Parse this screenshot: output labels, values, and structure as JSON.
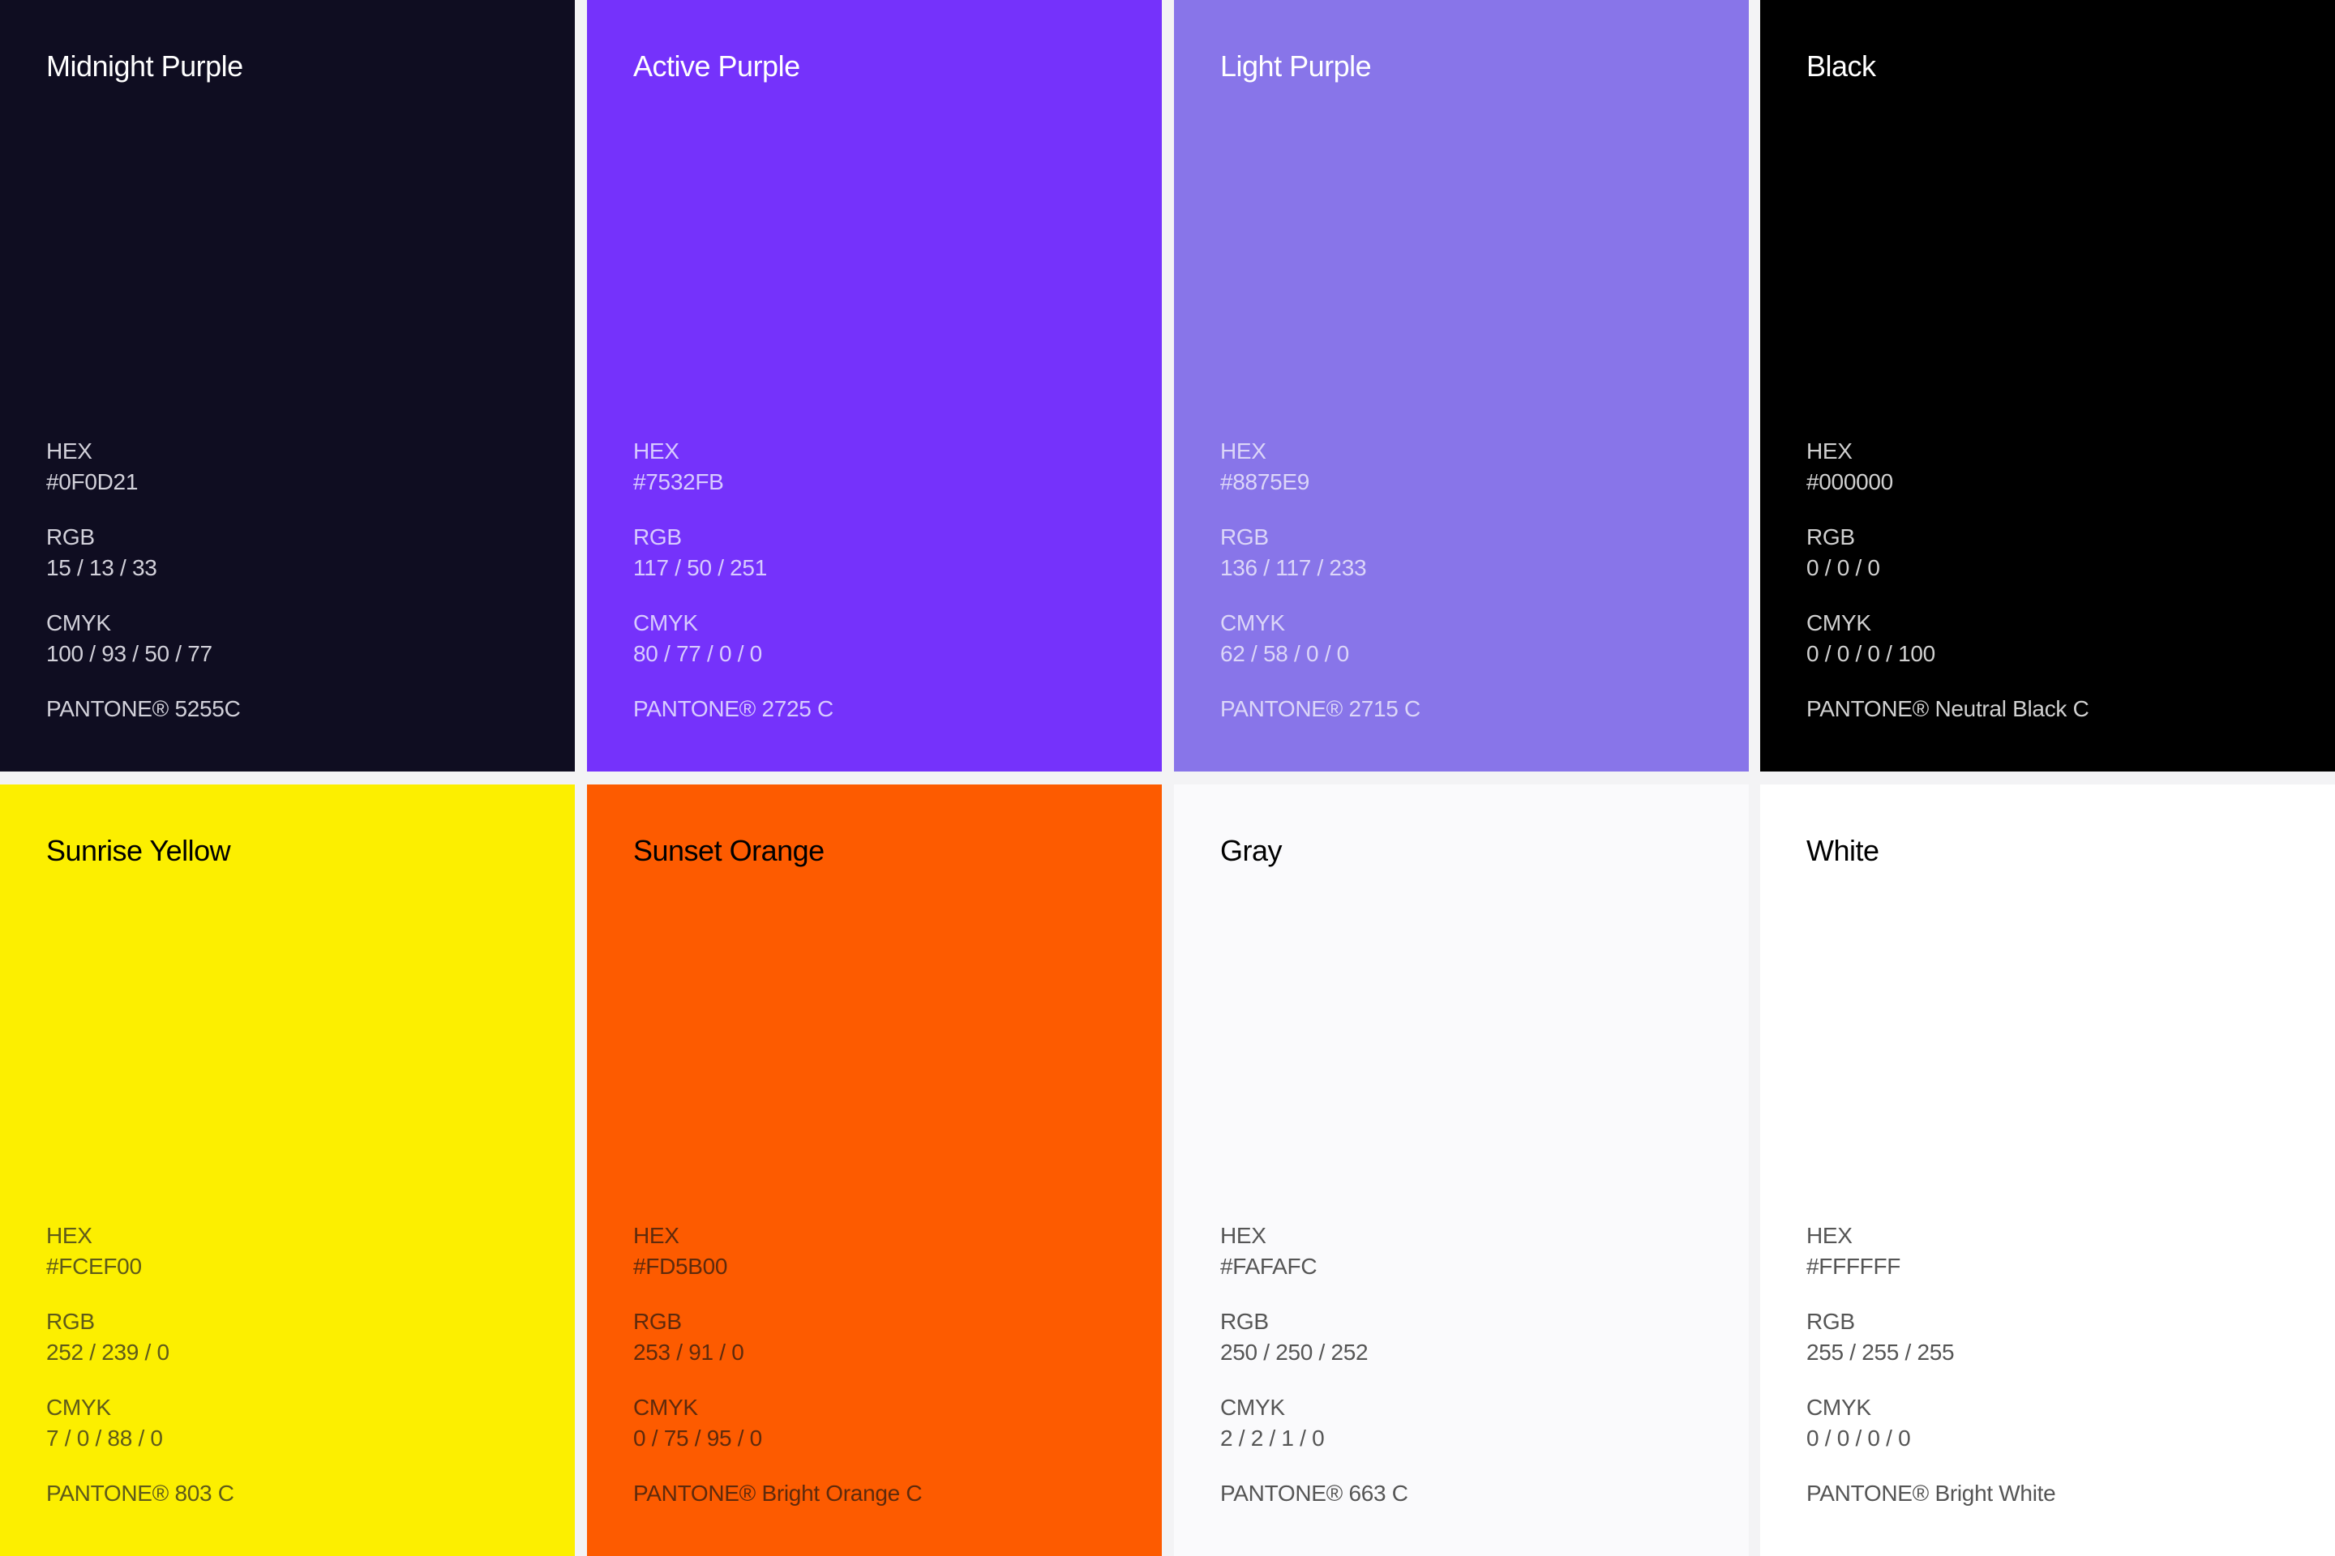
{
  "swatches": [
    {
      "name": "Midnight Purple",
      "bg": "#0F0D21",
      "name_color": "#FFFFFF",
      "text_color": "#D2D1DA",
      "hex_label": "HEX",
      "hex": "#0F0D21",
      "rgb_label": "RGB",
      "rgb": "15 / 13 / 33",
      "cmyk_label": "CMYK",
      "cmyk": "100 / 93 / 50 / 77",
      "pantone": "PANTONE® 5255C"
    },
    {
      "name": "Active Purple",
      "bg": "#7532FB",
      "name_color": "#FFFFFF",
      "text_color": "#D8CBFE",
      "hex_label": "HEX",
      "hex": "#7532FB",
      "rgb_label": "RGB",
      "rgb": "117 / 50 / 251",
      "cmyk_label": "CMYK",
      "cmyk": "80 / 77 / 0 / 0",
      "pantone": "PANTONE® 2725 C"
    },
    {
      "name": "Light Purple",
      "bg": "#8875E9",
      "name_color": "#FFFFFF",
      "text_color": "#DCD6F8",
      "hex_label": "HEX",
      "hex": "#8875E9",
      "rgb_label": "RGB",
      "rgb": "136 / 117 / 233",
      "cmyk_label": "CMYK",
      "cmyk": "62 / 58 / 0 / 0",
      "pantone": "PANTONE® 2715 C"
    },
    {
      "name": "Black",
      "bg": "#000000",
      "name_color": "#FFFFFF",
      "text_color": "#D0D0D0",
      "hex_label": "HEX",
      "hex": "#000000",
      "rgb_label": "RGB",
      "rgb": "0 / 0 / 0",
      "cmyk_label": "CMYK",
      "cmyk": "0 / 0 / 0 / 100",
      "pantone": "PANTONE® Neutral Black C"
    },
    {
      "name": "Sunrise Yellow",
      "bg": "#FCEF00",
      "name_color": "#000000",
      "text_color": "#5E5A1A",
      "hex_label": "HEX",
      "hex": "#FCEF00",
      "rgb_label": "RGB",
      "rgb": "252 / 239 / 0",
      "cmyk_label": "CMYK",
      "cmyk": "7 / 0 / 88 / 0",
      "pantone": "PANTONE® 803 C"
    },
    {
      "name": "Sunset Orange",
      "bg": "#FD5B00",
      "name_color": "#000000",
      "text_color": "#5E2A0C",
      "hex_label": "HEX",
      "hex": "#FD5B00",
      "rgb_label": "RGB",
      "rgb": "253 / 91 / 0",
      "cmyk_label": "CMYK",
      "cmyk": "0 / 75 / 95 / 0",
      "pantone": "PANTONE® Bright Orange C"
    },
    {
      "name": "Gray",
      "bg": "#FAFAFC",
      "name_color": "#000000",
      "text_color": "#555555",
      "hex_label": "HEX",
      "hex": "#FAFAFC",
      "rgb_label": "RGB",
      "rgb": "250 / 250 / 252",
      "cmyk_label": "CMYK",
      "cmyk": "2 / 2 / 1 / 0",
      "pantone": "PANTONE® 663 C"
    },
    {
      "name": "White",
      "bg": "#FFFFFF",
      "name_color": "#000000",
      "text_color": "#555555",
      "hex_label": "HEX",
      "hex": "#FFFFFF",
      "rgb_label": "RGB",
      "rgb": "255 / 255 / 255",
      "cmyk_label": "CMYK",
      "cmyk": "0 / 0 / 0 / 0",
      "pantone": "PANTONE® Bright White"
    }
  ]
}
